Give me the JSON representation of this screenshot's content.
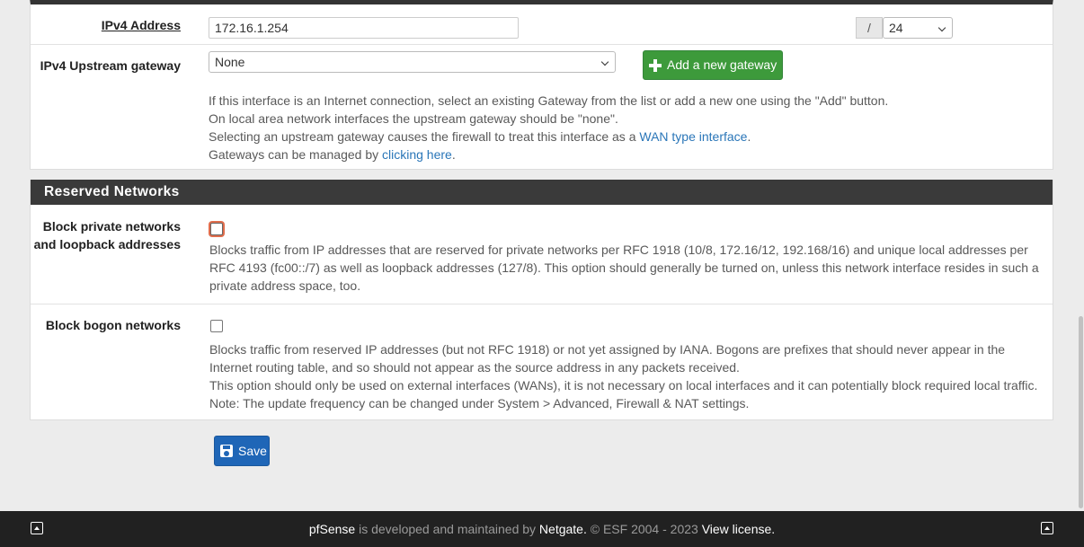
{
  "ipv4": {
    "label": "IPv4 Address",
    "value": "172.16.1.254",
    "slash": "/",
    "cidr": "24"
  },
  "gateway": {
    "label": "IPv4 Upstream gateway",
    "selected": "None",
    "add_button": "Add a new gateway",
    "help_line1": "If this interface is an Internet connection, select an existing Gateway from the list or add a new one using the \"Add\" button.",
    "help_line2": "On local area network interfaces the upstream gateway should be \"none\".",
    "help_line3_pre": "Selecting an upstream gateway causes the firewall to treat this interface as a ",
    "help_line3_link": "WAN type interface",
    "help_line3_post": ".",
    "help_line4_pre": "Gateways can be managed by ",
    "help_line4_link": "clicking here",
    "help_line4_post": "."
  },
  "reserved": {
    "heading": "Reserved Networks",
    "private": {
      "label_line1": "Block private networks",
      "label_line2": "and loopback addresses",
      "checked": false,
      "help": "Blocks traffic from IP addresses that are reserved for private networks per RFC 1918 (10/8, 172.16/12, 192.168/16) and unique local addresses per RFC 4193 (fc00::/7) as well as loopback addresses (127/8). This option should generally be turned on, unless this network interface resides in such a private address space, too."
    },
    "bogon": {
      "label": "Block bogon networks",
      "checked": false,
      "help_line1": "Blocks traffic from reserved IP addresses (but not RFC 1918) or not yet assigned by IANA. Bogons are prefixes that should never appear in the Internet routing table, and so should not appear as the source address in any packets received.",
      "help_line2": "This option should only be used on external interfaces (WANs), it is not necessary on local interfaces and it can potentially block required local traffic.",
      "help_line3": "Note: The update frequency can be changed under System > Advanced, Firewall & NAT settings."
    }
  },
  "save_button": "Save",
  "footer": {
    "product": "pfSense",
    "text1": " is developed and maintained by ",
    "company": "Netgate.",
    "text2": " © ESF 2004 - 2023 ",
    "license": "View license."
  },
  "icons": {
    "add": "plus-icon",
    "save": "save-icon",
    "footer_left": "scroll-top-icon",
    "footer_right": "scroll-top-icon"
  }
}
